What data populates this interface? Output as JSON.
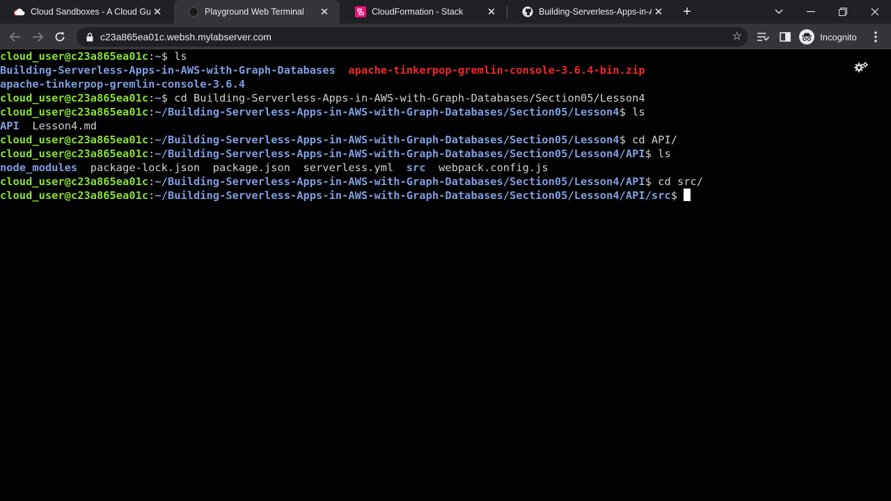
{
  "tabs": [
    {
      "title": "Cloud Sandboxes - A Cloud Guru",
      "icon": "cloud-icon"
    },
    {
      "title": "Playground Web Terminal",
      "icon": "terminal-icon",
      "active": true
    },
    {
      "title": "CloudFormation - Stack",
      "icon": "cloudformation-icon"
    },
    {
      "title": "Building-Serverless-Apps-in-AWS",
      "icon": "github-icon"
    }
  ],
  "toolbar": {
    "url": "c23a865ea01c.websh.mylabserver.com",
    "profile_label": "Incognito"
  },
  "terminal": {
    "prompt_user": "cloud_user@c23a865ea01c",
    "lines": [
      {
        "path": "~",
        "cmd": "ls"
      },
      {
        "output": [
          {
            "text": "Building-Serverless-Apps-in-AWS-with-Graph-Databases",
            "kind": "dir"
          },
          {
            "text": "  ",
            "kind": "txt"
          },
          {
            "text": "apache-tinkerpop-gremlin-console-3.6.4-bin.zip",
            "kind": "arc"
          }
        ]
      },
      {
        "output": [
          {
            "text": "apache-tinkerpop-gremlin-console-3.6.4",
            "kind": "dir"
          }
        ]
      },
      {
        "path": "~",
        "cmd": "cd Building-Serverless-Apps-in-AWS-with-Graph-Databases/Section05/Lesson4"
      },
      {
        "path": "~/Building-Serverless-Apps-in-AWS-with-Graph-Databases/Section05/Lesson4",
        "cmd": "ls"
      },
      {
        "output": [
          {
            "text": "API",
            "kind": "dir"
          },
          {
            "text": "  Lesson4.md",
            "kind": "txt"
          }
        ]
      },
      {
        "path": "~/Building-Serverless-Apps-in-AWS-with-Graph-Databases/Section05/Lesson4",
        "cmd": "cd API/"
      },
      {
        "path": "~/Building-Serverless-Apps-in-AWS-with-Graph-Databases/Section05/Lesson4/API",
        "cmd": "ls"
      },
      {
        "output": [
          {
            "text": "node_modules",
            "kind": "dir"
          },
          {
            "text": "  package-lock.json  package.json  serverless.yml  ",
            "kind": "txt"
          },
          {
            "text": "src",
            "kind": "dir"
          },
          {
            "text": "  webpack.config.js",
            "kind": "txt"
          }
        ]
      },
      {
        "path": "~/Building-Serverless-Apps-in-AWS-with-Graph-Databases/Section05/Lesson4/API",
        "cmd": "cd src/"
      },
      {
        "path": "~/Building-Serverless-Apps-in-AWS-with-Graph-Databases/Section05/Lesson4/API/src",
        "cmd": "",
        "cursor": true
      }
    ]
  },
  "colors": {
    "user": "#8ae234",
    "path": "#7f9fe0",
    "archive": "#ef2929",
    "text": "#d0d0d0"
  }
}
